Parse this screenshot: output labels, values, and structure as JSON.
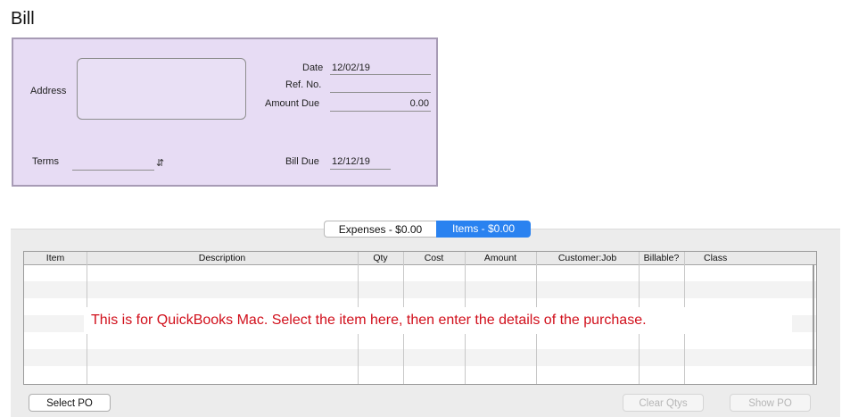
{
  "window": {
    "title": "Bill"
  },
  "header": {
    "address_label": "Address",
    "terms_label": "Terms",
    "terms_value": "",
    "date_label": "Date",
    "date_value": "12/02/19",
    "ref_label": "Ref. No.",
    "ref_value": "",
    "amount_due_label": "Amount Due",
    "amount_due_value": "0.00",
    "bill_due_label": "Bill Due",
    "bill_due_value": "12/12/19"
  },
  "tabs": [
    {
      "label": "Expenses - $0.00",
      "selected": false
    },
    {
      "label": "Items - $0.00",
      "selected": true
    }
  ],
  "table": {
    "columns": [
      "Item",
      "Description",
      "Qty",
      "Cost",
      "Amount",
      "Customer:Job",
      "Billable?",
      "Class"
    ]
  },
  "annotation": "This is for QuickBooks Mac. Select the item here, then enter the details of the purchase.",
  "buttons": {
    "select_po": "Select PO",
    "clear_qtys": "Clear Qtys",
    "show_po": "Show PO"
  },
  "colors": {
    "panel_bg": "#e7dcf4",
    "tab_selected": "#2a82f0",
    "annotation_text": "#d10f1b"
  }
}
